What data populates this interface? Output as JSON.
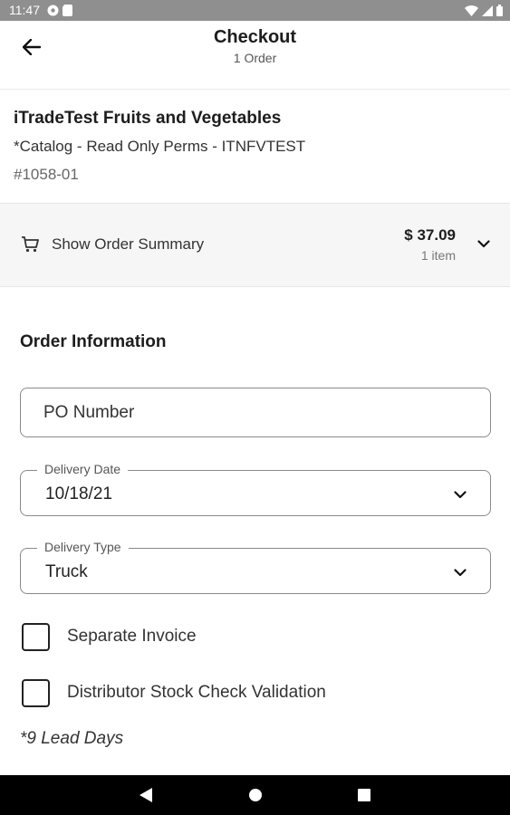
{
  "status_bar": {
    "time": "11:47",
    "icons": [
      "gear-icon",
      "sim-icon",
      "wifi-icon",
      "signal-icon",
      "battery-icon"
    ]
  },
  "header": {
    "title": "Checkout",
    "subtitle": "1 Order",
    "back_icon": "arrow-left-icon"
  },
  "vendor": {
    "name": "iTradeTest Fruits and Vegetables",
    "catalog": "*Catalog - Read Only Perms - ITNFVTEST",
    "account": "#1058-01"
  },
  "summary": {
    "icon": "cart-icon",
    "label": "Show Order Summary",
    "amount": "$ 37.09",
    "items": "1 item",
    "expand_icon": "chevron-down-icon"
  },
  "order_info": {
    "title": "Order Information",
    "po_number": {
      "placeholder": "PO Number",
      "value": ""
    },
    "delivery_date": {
      "label": "Delivery Date",
      "value": "10/18/21"
    },
    "delivery_type": {
      "label": "Delivery Type",
      "value": "Truck"
    },
    "separate_invoice": {
      "label": "Separate Invoice",
      "checked": false
    },
    "stock_check": {
      "label": "Distributor Stock Check Validation",
      "checked": false
    },
    "lead_days": "*9 Lead Days"
  },
  "nav_bar": {
    "icons": [
      "back-triangle-icon",
      "home-circle-icon",
      "recents-square-icon"
    ]
  },
  "colors": {
    "status_bar": "#8f8f8f",
    "summary_bg": "#f6f6f6",
    "nav_bar": "#000000",
    "border": "#8a8a8a"
  }
}
